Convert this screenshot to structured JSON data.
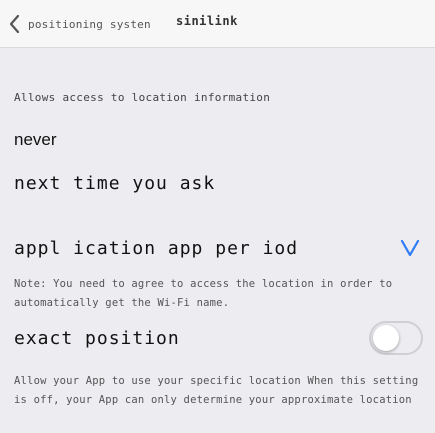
{
  "nav": {
    "back_label": "positioning systen",
    "title": "sinilink"
  },
  "section_header": "Allows access to location information",
  "options": [
    {
      "label": "never",
      "selected": false
    },
    {
      "label": "next time you ask",
      "selected": false
    },
    {
      "label": "appl ication app per iod",
      "selected": true
    }
  ],
  "note_1": "Note: You need to agree to access the location in order to automatically get the Wi-Fi name.",
  "exact_position": {
    "label": "exact position",
    "enabled": false
  },
  "note_2": "Allow your App to use your specific location When this setting is off, your App can only determine your approximate location",
  "colors": {
    "accent": "#2f7cf6",
    "background": "#ececf1",
    "nav_background": "#f7f7f7"
  },
  "icons": {
    "back": "chevron-left-icon",
    "selected": "checkmark-icon"
  }
}
